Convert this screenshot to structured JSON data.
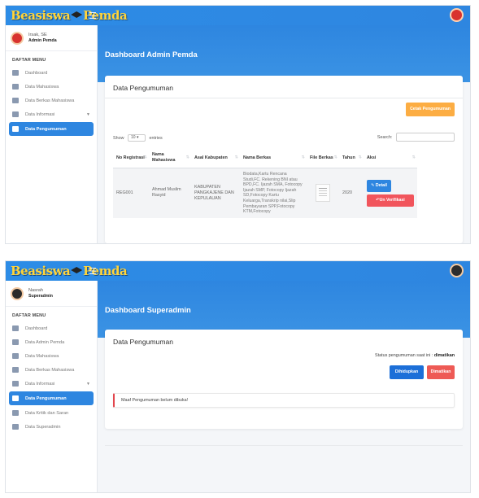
{
  "screen1": {
    "brand": {
      "word1": "Beasiswa",
      "word2": "Pemda"
    },
    "user": {
      "name": "Irsak, SE",
      "role": "Admin Pemda"
    },
    "menu_header": "DAFTAR MENU",
    "menu": [
      {
        "label": "Dashboard"
      },
      {
        "label": "Data Mahasiswa"
      },
      {
        "label": "Data Berkas Mahasiswa"
      },
      {
        "label": "Data Informasi"
      },
      {
        "label": "Data Pengumuman"
      }
    ],
    "banner_title": "Dashboard Admin Pemda",
    "card_title": "Data Pengumuman",
    "print_button": "Cetak Pengumuman",
    "show_label": "Show",
    "length_value": "10",
    "entries_label": "entries",
    "search_label": "Search:",
    "columns": [
      "No Registrasi",
      "Nama Mahasiswa",
      "Asal Kabupaten",
      "Nama Berkas",
      "File Berkas",
      "Tahun",
      "Aksi"
    ],
    "row": {
      "no": "REG001",
      "nama": "Ahmad Muslim Rasyid",
      "asal": "KABUPATEN PANGKAJENE DAN KEPULAUAN",
      "berkas": "Biodata,Kartu Rencana Studi,FC. Rekening BNI atau BPD,FC. Ijazah SMA, Fotocopy Ijazah SMP, Fotocopy Ijazah SD,Fotocopy Kartu Keluarga,Transkrip nilai,Slip Pembayaran SPP,Fotocopy KTM,Fotocopy",
      "tahun": "2020",
      "detail_label": "Detail",
      "verif_label": "Un Verifikasi"
    }
  },
  "screen2": {
    "brand": {
      "word1": "Beasiswa",
      "word2": "Pemda"
    },
    "user": {
      "name": "Nasrah",
      "role": "Superadmin"
    },
    "menu_header": "DAFTAR MENU",
    "menu": [
      {
        "label": "Dashboard"
      },
      {
        "label": "Data Admin Pemda"
      },
      {
        "label": "Data Mahasiswa"
      },
      {
        "label": "Data Berkas Mahasiswa"
      },
      {
        "label": "Data Informasi"
      },
      {
        "label": "Data Pengumuman"
      },
      {
        "label": "Data Kritik dan Saran"
      },
      {
        "label": "Data Superadmin"
      }
    ],
    "banner_title": "Dashboard Superadmin",
    "card_title": "Data Pengumuman",
    "status_text": "Status pengumuman saat ini :",
    "status_value": "dimatikan",
    "on_button": "Dihidupkan",
    "off_button": "Dimatikan",
    "alert_text": "Maaf Pengumuman belum dibuka!"
  },
  "colors": {
    "primary": "#2e86e0",
    "orange": "#fcad43",
    "danger": "#f1555c",
    "brand_yellow": "#ffd43a"
  },
  "icons": [
    "hamburger-icon",
    "user-avatar-icon",
    "home-icon",
    "graduation-cap-icon",
    "folder-icon",
    "info-icon",
    "list-icon",
    "chat-icon",
    "download-icon",
    "edit-icon",
    "undo-icon"
  ]
}
